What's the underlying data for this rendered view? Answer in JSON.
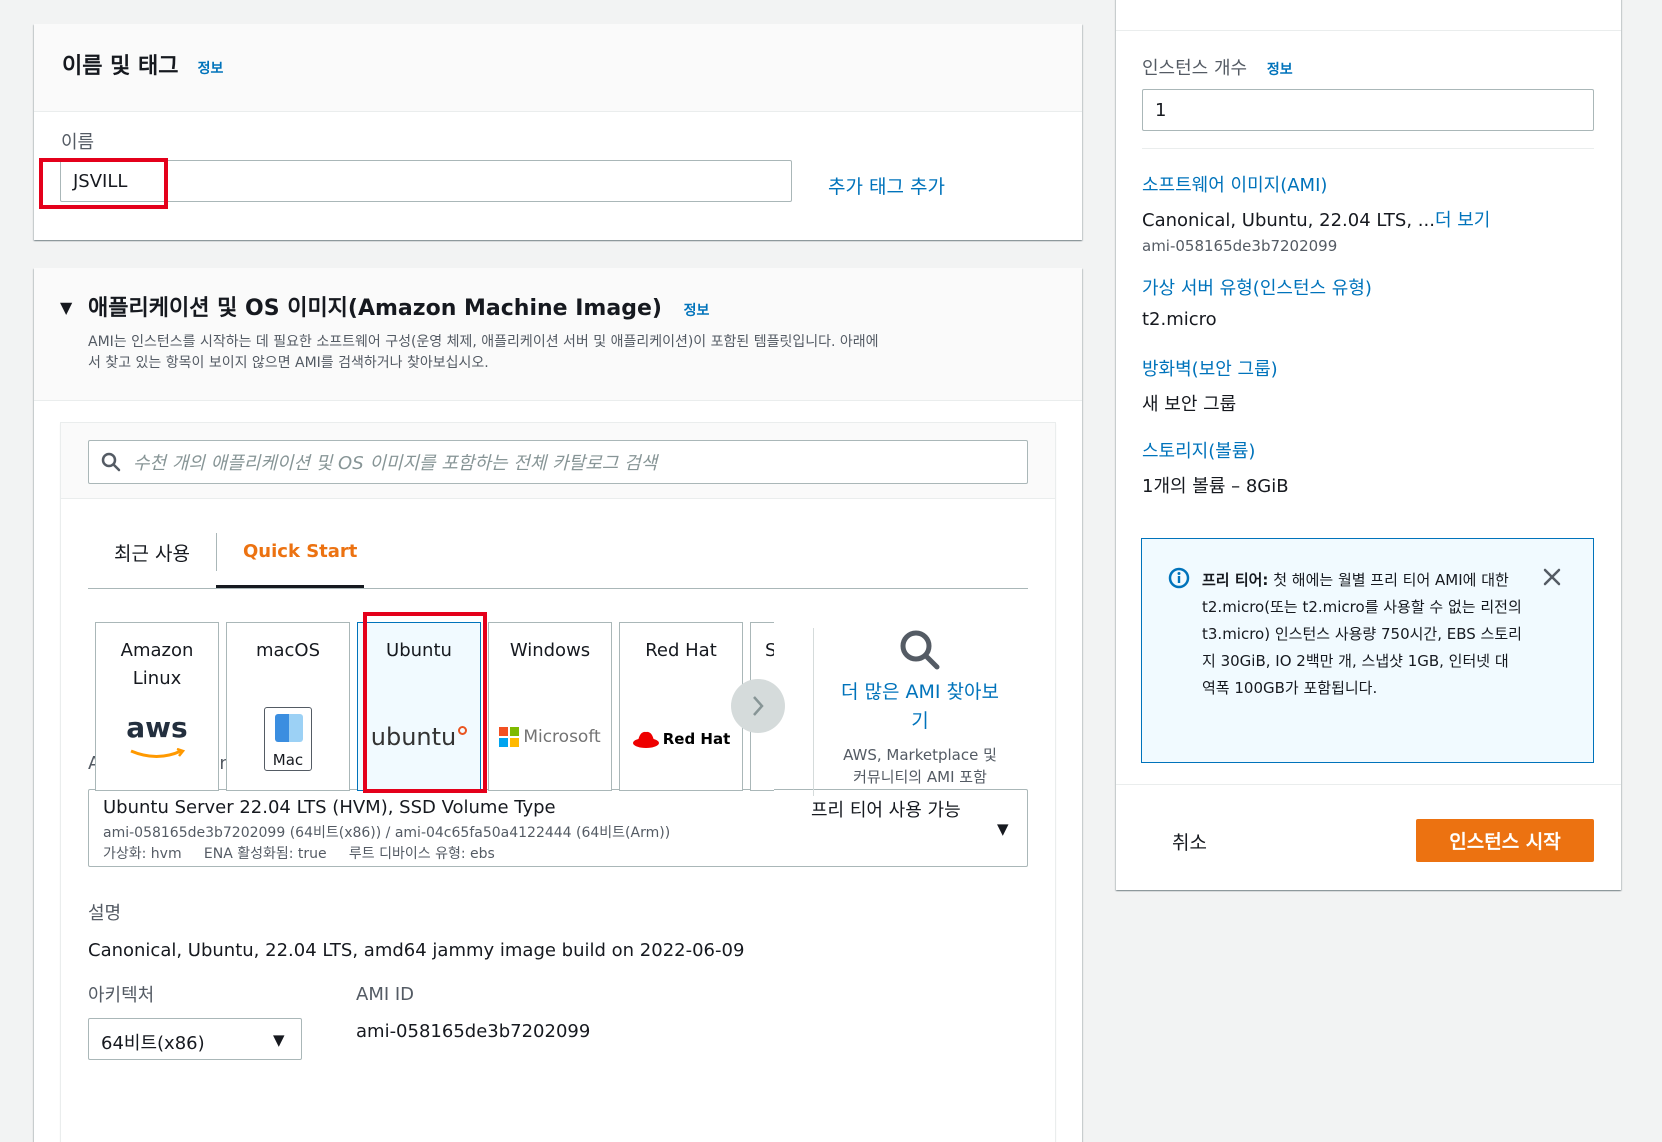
{
  "name_tags": {
    "title": "이름 및 태그",
    "info": "정보",
    "name_label": "이름",
    "name_value": "JSVILL",
    "add_tag_link": "추가 태그 추가"
  },
  "ami_section": {
    "title": "애플리케이션 및 OS 이미지(Amazon Machine Image)",
    "info": "정보",
    "description_line1": "AMI는 인스턴스를 시작하는 데 필요한 소프트웨어 구성(운영 체제, 애플리케이션 서버 및 애플리케이션)이 포함된 템플릿입니다. 아래에",
    "description_line2": "서 찾고 있는 항목이 보이지 않으면 AMI를 검색하거나 찾아보십시오.",
    "search_placeholder": "수천 개의 애플리케이션 및 OS 이미지를 포함하는 전체 카탈로그 검색",
    "tabs": [
      "최근 사용",
      "Quick Start"
    ],
    "tiles": [
      {
        "label_line1": "Amazon",
        "label_line2": "Linux",
        "logo": "aws"
      },
      {
        "label_line1": "macOS",
        "label_line2": "",
        "logo": "Mac"
      },
      {
        "label_line1": "Ubuntu",
        "label_line2": "",
        "logo": "ubuntu"
      },
      {
        "label_line1": "Windows",
        "label_line2": "",
        "logo": "Microsoft"
      },
      {
        "label_line1": "Red Hat",
        "label_line2": "",
        "logo": "Red Hat"
      },
      {
        "label_line1": "S",
        "label_line2": "",
        "logo": ""
      }
    ],
    "more_ami_line1": "더 많은 AMI 찾아보",
    "more_ami_line2": "기",
    "more_ami_sub_line1": "AWS, Marketplace 및",
    "more_ami_sub_line2": "커뮤니티의 AMI 포함",
    "ami_label": "Amazon Machine Image(AMI)",
    "ami_name": "Ubuntu Server 22.04 LTS (HVM), SSD Volume Type",
    "ami_free_tier": "프리 티어 사용 가능",
    "ami_ids": "ami-058165de3b7202099 (64비트(x86)) / ami-04c65fa50a4122444 (64비트(Arm))",
    "ami_virt": "가상화: hvm",
    "ami_ena": "ENA 활성화됨: true",
    "ami_root": "루트 디바이스 유형: ebs",
    "desc_label": "설명",
    "desc_value": "Canonical, Ubuntu, 22.04 LTS, amd64 jammy image build on 2022-06-09",
    "arch_label": "아키텍처",
    "arch_value": "64비트(x86)",
    "amiid_label": "AMI ID",
    "amiid_value": "ami-058165de3b7202099"
  },
  "summary": {
    "count_label": "인스턴스 개수",
    "info": "정보",
    "count_value": "1",
    "software_label": "소프트웨어 이미지(AMI)",
    "software_value": "Canonical, Ubuntu, 22.04 LTS, ...",
    "software_more": "더 보기",
    "software_id": "ami-058165de3b7202099",
    "type_label": "가상 서버 유형(인스턴스 유형)",
    "type_value": "t2.micro",
    "firewall_label": "방화벽(보안 그룹)",
    "firewall_value": "새 보안 그룹",
    "storage_label": "스토리지(볼륨)",
    "storage_value": "1개의 볼륨 – 8GiB",
    "alert_bold": "프리 티어:",
    "alert_text": "첫 해에는 월별 프리 티어 AMI에 대한 t2.micro(또는 t2.micro를 사용할 수 없는 리전의 t3.micro) 인스턴스 사용량 750시간, EBS 스토리지 30GiB, IO 2백만 개, 스냅샷 1GB, 인터넷 대역폭 100GB가 포함됩니다.",
    "cancel": "취소",
    "launch": "인스턴스 시작"
  },
  "colors": {
    "accent": "#ec7211",
    "link": "#0073bb",
    "highlight": "#e4001b"
  }
}
